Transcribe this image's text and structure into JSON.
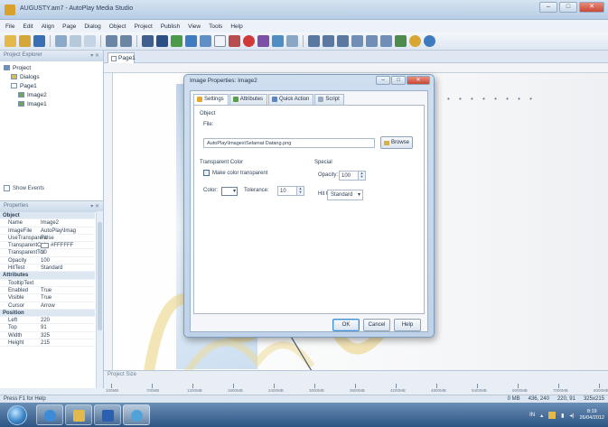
{
  "window": {
    "title": "AUGUSTY.am7 - AutoPlay Media Studio",
    "minimize": "–",
    "maximize": "□",
    "close": "✕"
  },
  "menu": [
    "File",
    "Edit",
    "Align",
    "Page",
    "Dialog",
    "Object",
    "Project",
    "Publish",
    "View",
    "Tools",
    "Help"
  ],
  "project_explorer": {
    "header": "Project Explorer",
    "pin": "▾ ✕",
    "tree": [
      {
        "label": "Project",
        "level": 0,
        "icon": "project-icon"
      },
      {
        "label": "Dialogs",
        "level": 1,
        "icon": "folder-icon"
      },
      {
        "label": "Page1",
        "level": 1,
        "icon": "page-icon"
      },
      {
        "label": "Image2",
        "level": 2,
        "icon": "image-icon"
      },
      {
        "label": "Image1",
        "level": 2,
        "icon": "image-icon"
      }
    ],
    "show_events": "Show Events"
  },
  "properties": {
    "header": "Properties",
    "rows": [
      {
        "k": "Object",
        "v": "",
        "cat": true
      },
      {
        "k": "Name",
        "v": "Image2"
      },
      {
        "k": "ImageFile",
        "v": "AutoPlay\\Imag"
      },
      {
        "k": "UseTransparent",
        "v": "False"
      },
      {
        "k": "TransparentCol",
        "v": "#FFFFFF",
        "swatch": true
      },
      {
        "k": "TransparentTol",
        "v": "10"
      },
      {
        "k": "Opacity",
        "v": "100"
      },
      {
        "k": "HitTest",
        "v": "Standard"
      },
      {
        "k": "Attributes",
        "v": "",
        "cat": true
      },
      {
        "k": "TooltipText",
        "v": ""
      },
      {
        "k": "Enabled",
        "v": "True"
      },
      {
        "k": "Visible",
        "v": "True"
      },
      {
        "k": "Cursor",
        "v": "Arrow"
      },
      {
        "k": "Position",
        "v": "",
        "cat": true
      },
      {
        "k": "Left",
        "v": "220"
      },
      {
        "k": "Top",
        "v": "91"
      },
      {
        "k": "Width",
        "v": "325"
      },
      {
        "k": "Height",
        "v": "215"
      }
    ]
  },
  "tabs": {
    "page_tab": "Page1"
  },
  "project_size": {
    "label": "Project Size",
    "ticks": [
      "100MB",
      "700MB",
      "1200MB",
      "1800MB",
      "2400MB",
      "3000MB",
      "3600MB",
      "4200MB",
      "4800MB",
      "5400MB",
      "6000MB",
      "7000MB",
      "8000MB"
    ]
  },
  "status": {
    "help": "Press F1 for Help",
    "size": "0 MB",
    "coords": "436, 240",
    "pos": "220, 91",
    "dims": "325x215"
  },
  "dialog": {
    "title": "Image Properties: Image2",
    "tabs": [
      "Settings",
      "Attributes",
      "Quick Action",
      "Script"
    ],
    "object_group": "Object",
    "file_label": "File:",
    "file_value": "AutoPlay\\Images\\Selamat Datang.png",
    "browse": "Browse",
    "transparent_group": "Transparent Color",
    "make_transparent": "Make color transparent",
    "color_label": "Color:",
    "tolerance_label": "Tolerance:",
    "tolerance_value": "10",
    "special_group": "Special",
    "opacity_label": "Opacity:",
    "opacity_value": "100",
    "hittest_label": "Hit test:",
    "hittest_value": "Standard",
    "ok": "OK",
    "cancel": "Cancel",
    "help": "Help",
    "min": "–",
    "max": "□",
    "close": "✕"
  },
  "tray": {
    "lang": "IN",
    "time": "8:19",
    "date": "26/04/2012"
  },
  "colors": {
    "accent": "#3f8fd1",
    "title_bar": "#c7d8ec",
    "taskbar": "#2d5584"
  }
}
